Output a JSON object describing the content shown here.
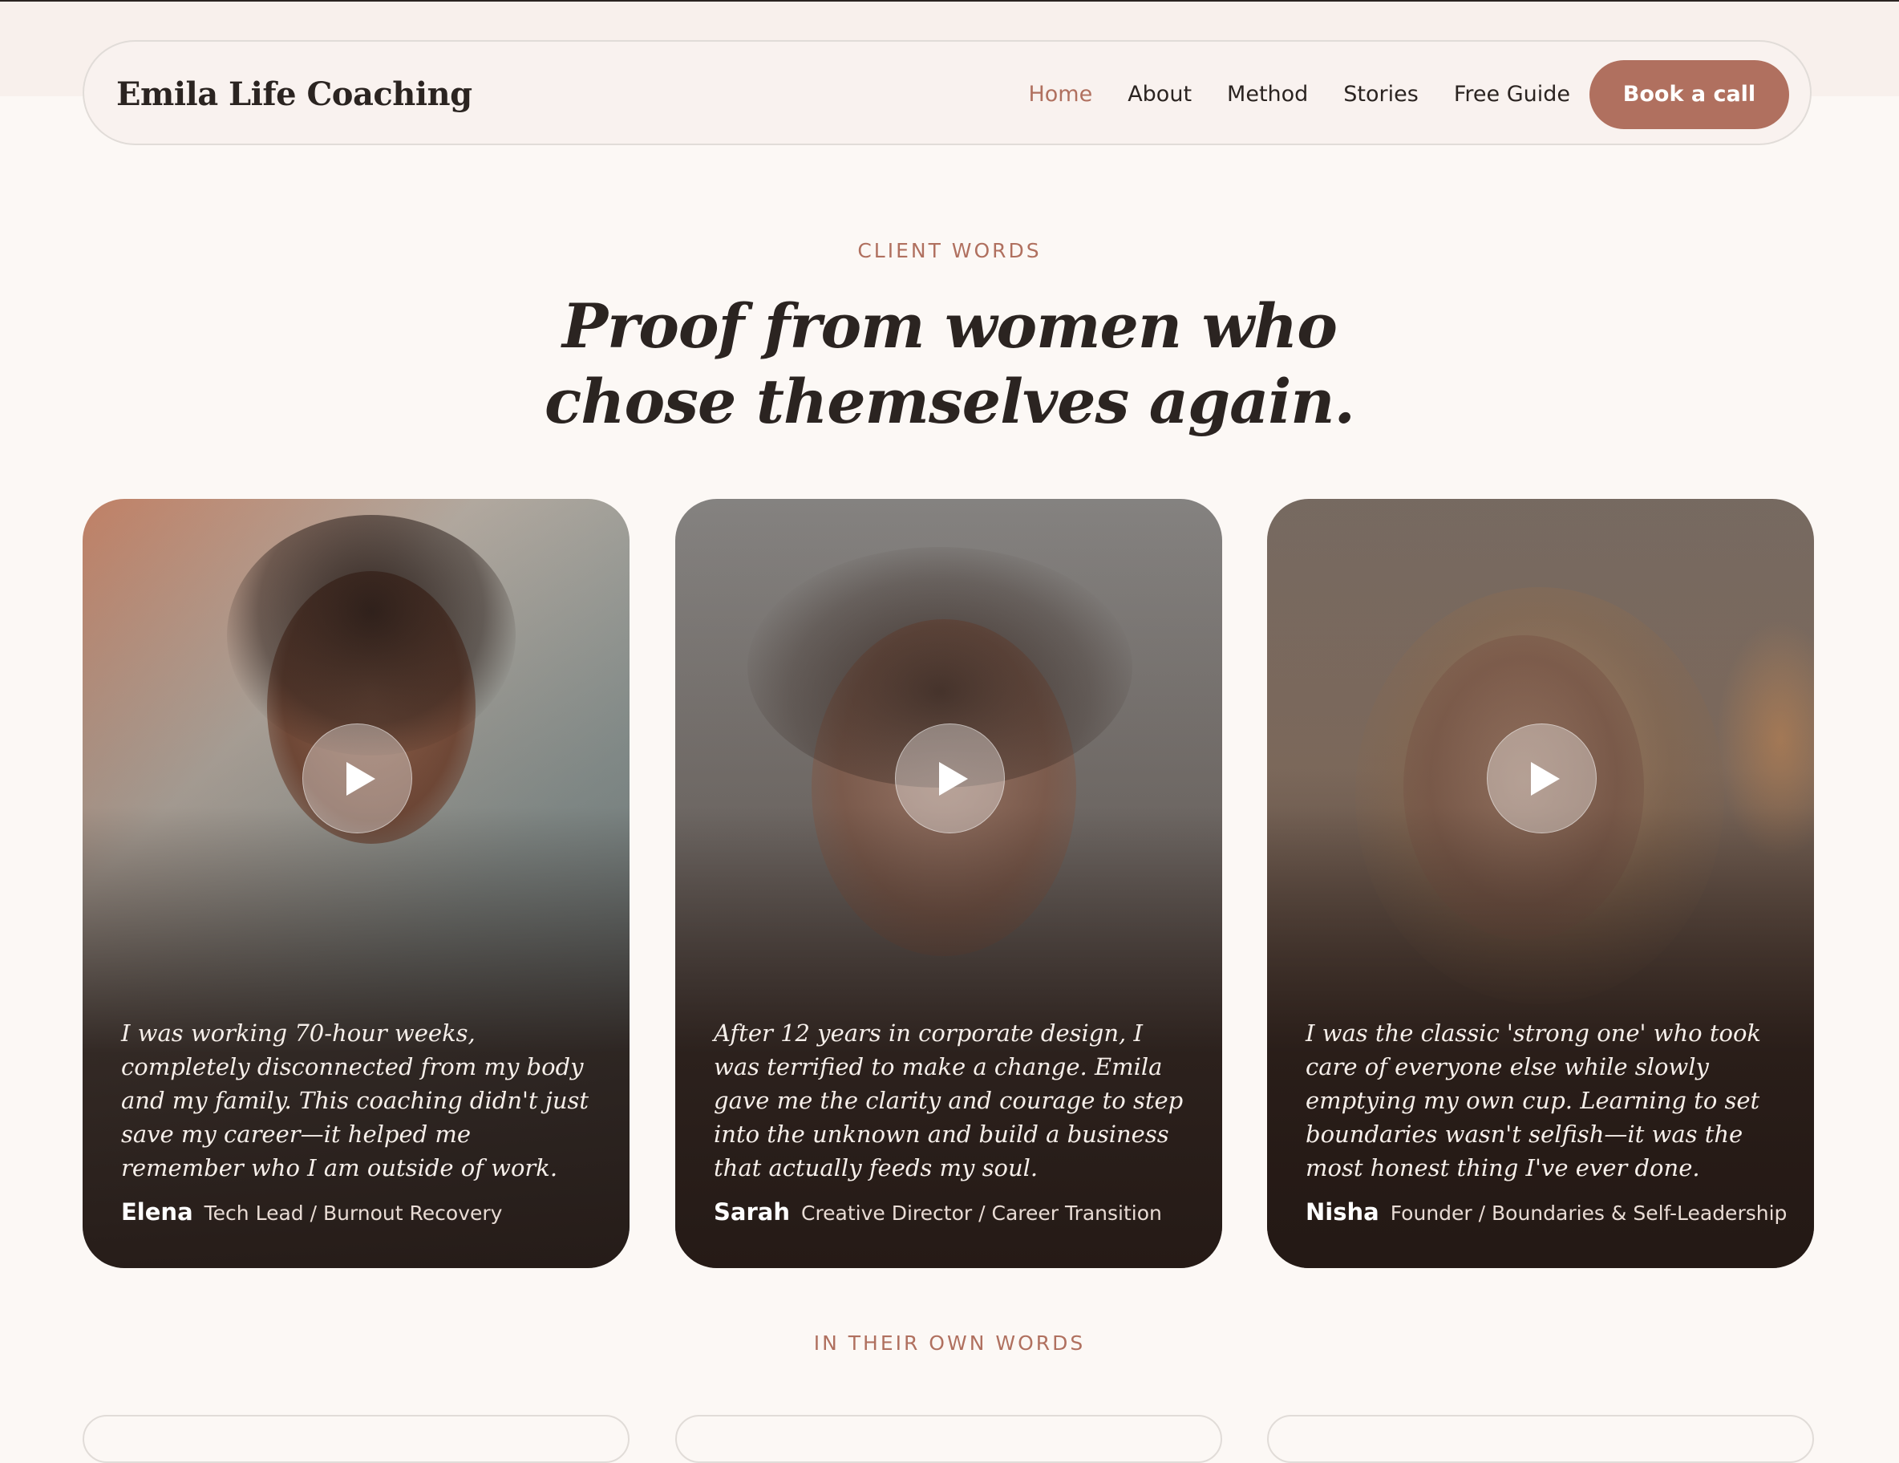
{
  "header": {
    "brand": "Emila Life Coaching",
    "nav": [
      "Home",
      "About",
      "Method",
      "Stories",
      "Free Guide"
    ],
    "active_nav": "Home",
    "cta_label": "Book a call"
  },
  "hero": {
    "eyebrow": "CLIENT WORDS",
    "title_line1": "Proof from women who",
    "title_line2": "chose themselves again."
  },
  "testimonials": [
    {
      "quote": "I was working 70-hour weeks, completely disconnected from my body and my family. This coaching didn't just save my career—it helped me remember who I am outside of work.",
      "name": "Elena",
      "role": "Tech Lead / Burnout Recovery",
      "play_icon": "play-icon"
    },
    {
      "quote": "After 12 years in corporate design, I was terrified to make a change. Emila gave me the clarity and courage to step into the unknown and build a business that actually feeds my soul.",
      "name": "Sarah",
      "role": "Creative Director / Career Transition",
      "play_icon": "play-icon"
    },
    {
      "quote": "I was the classic 'strong one' who took care of everyone else while slowly emptying my own cup. Learning to set boundaries wasn't selfish—it was the most honest thing I've ever done.",
      "name": "Nisha",
      "role": "Founder / Boundaries & Self-Leadership",
      "play_icon": "play-icon"
    }
  ],
  "section2": {
    "eyebrow": "IN THEIR OWN WORDS"
  },
  "colors": {
    "accent": "#b0705f",
    "background": "#fcf8f5",
    "text": "#2b2421"
  }
}
